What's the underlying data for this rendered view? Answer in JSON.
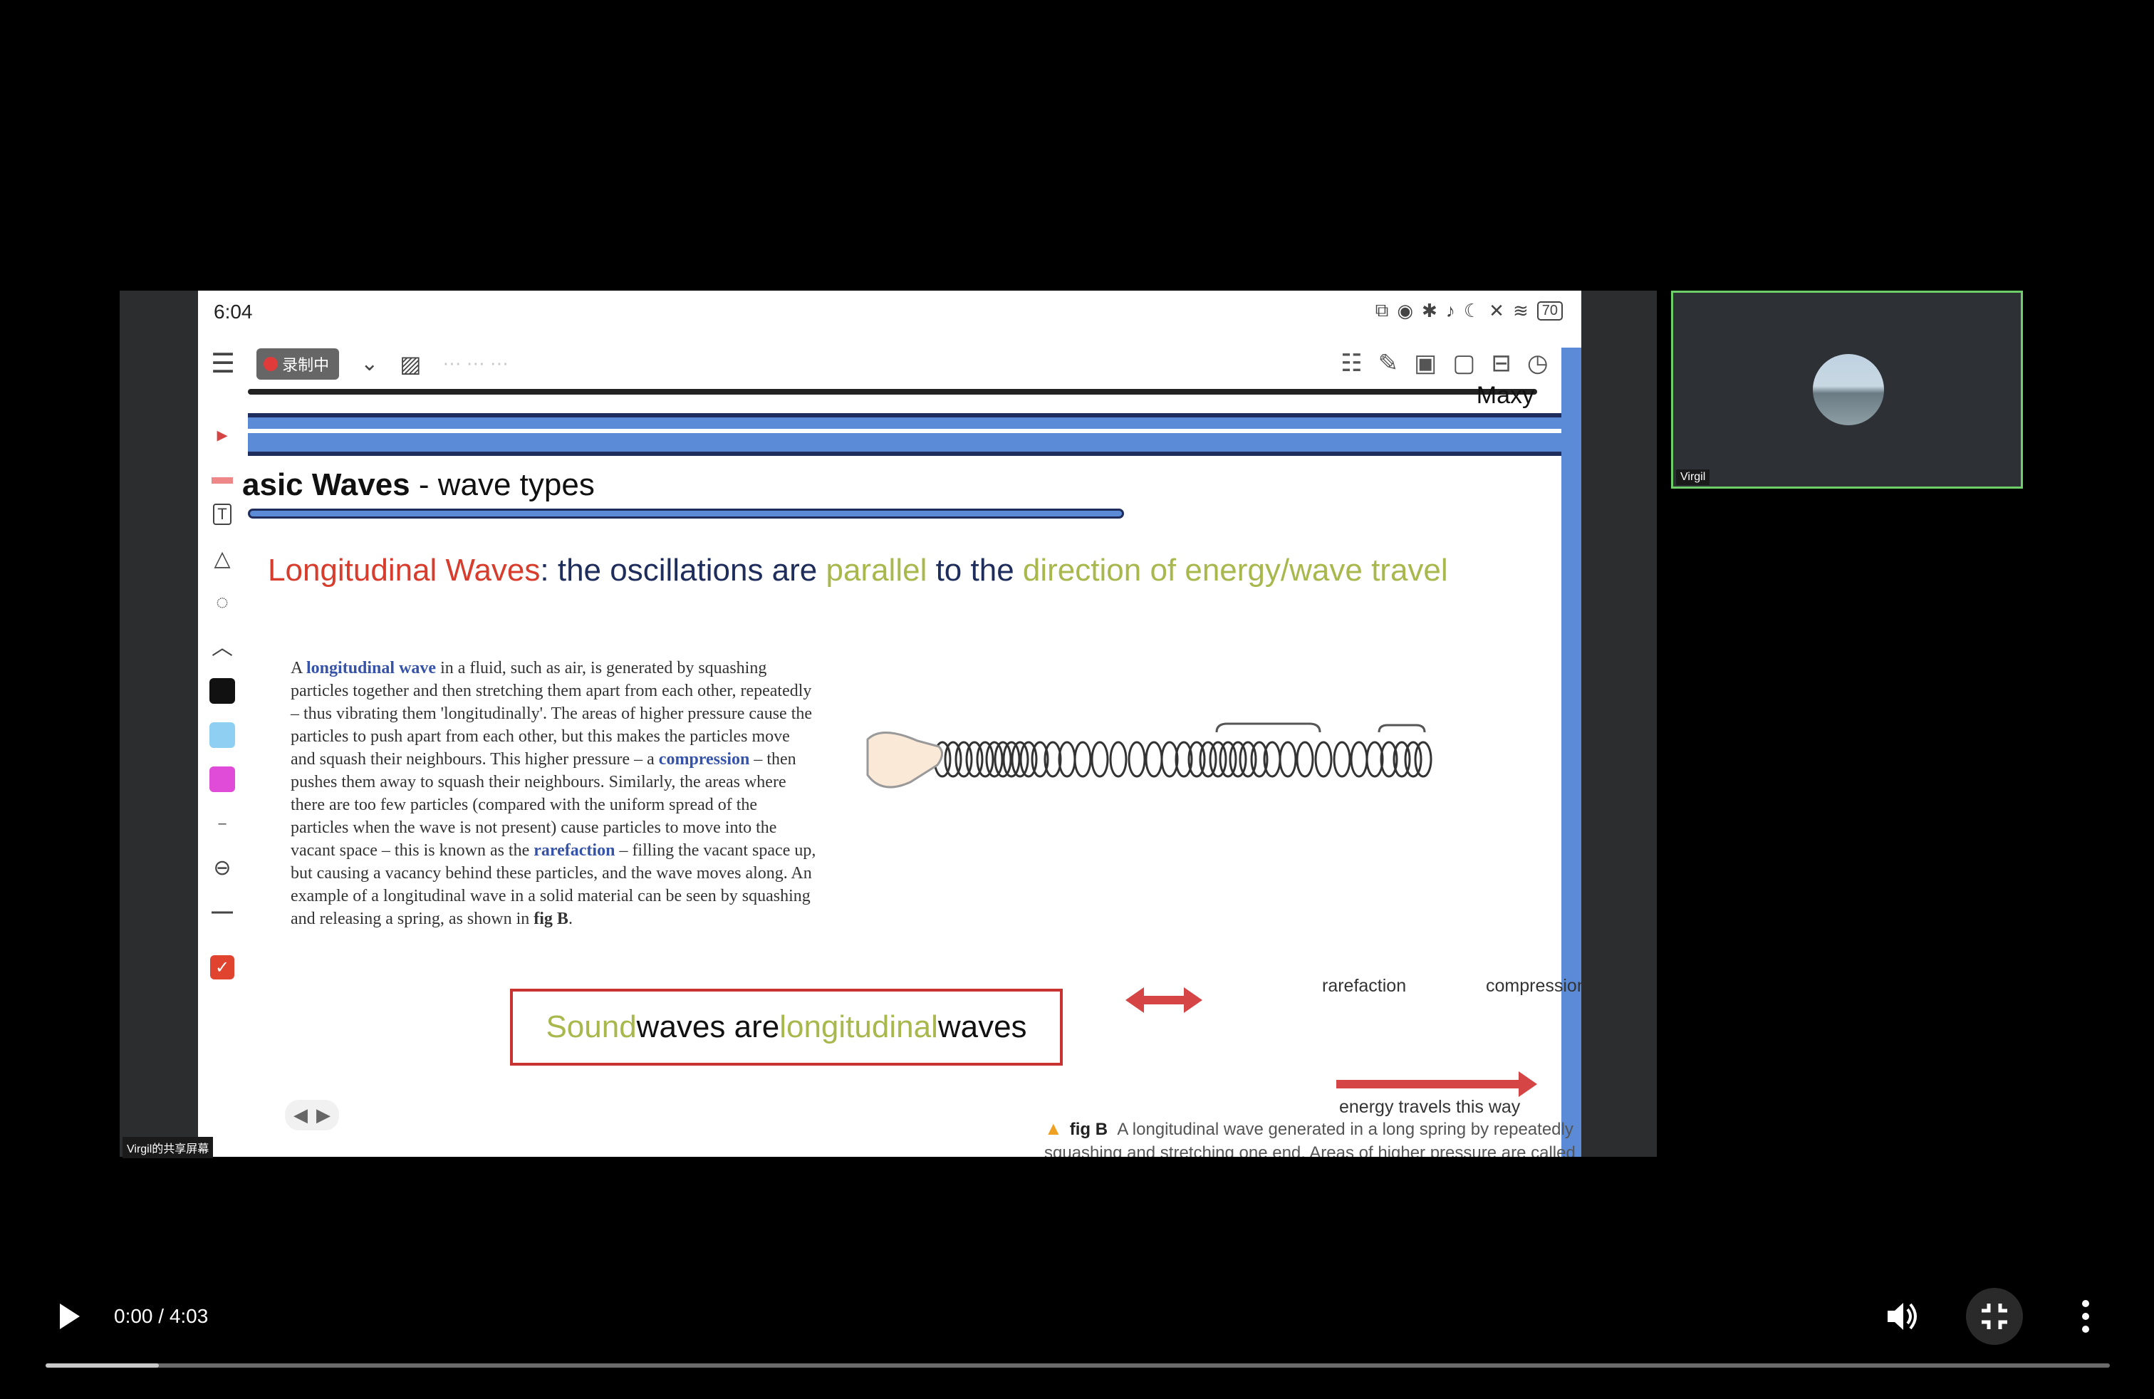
{
  "sharer_label": "Virgil的共享屏幕",
  "tablet": {
    "status_time": "6:04",
    "battery": "70",
    "recording_label": "录制中",
    "user_label": "Maxy"
  },
  "slide": {
    "title_bold": "asic Waves",
    "title_rest": " - wave types",
    "heading": {
      "part1": "Longitudinal Waves",
      "part2": ":  the oscillations are ",
      "part3": "parallel",
      "part4": " to the ",
      "part5": "direction of energy/wave travel"
    },
    "body": {
      "t1": "A ",
      "k1": "longitudinal wave",
      "t2": " in a fluid, such as air, is generated by squashing particles together and then stretching them apart from each other, repeatedly – thus vibrating them 'longitudinally'. The areas of higher pressure cause the particles to push apart from each other, but this makes the particles move and squash their neighbours. This higher pressure – a ",
      "k2": "compression",
      "t3": " – then pushes them away to squash their neighbours. Similarly, the areas where there are too few particles (compared with the uniform spread of the particles when the wave is not present) cause particles to move into the vacant space – this is known as the ",
      "k3": "rarefaction",
      "t4": " – filling the vacant space up, but causing a vacancy behind these particles, and the wave moves along. An example of a longitudinal wave in a solid material can be seen by squashing and releasing a spring, as shown in ",
      "k4": "fig B",
      "t5": "."
    },
    "figure": {
      "rarefaction": "rarefaction",
      "compression": "compression",
      "energy": "energy travels this way",
      "caption_label": "fig B",
      "caption_text": "A longitudinal wave generated in a long spring by repeatedly squashing and stretching one end. Areas of higher pressure are called compressions, and areas of lower pressure are called rarefactions."
    },
    "callout": {
      "w1": "Sound",
      "w2": " waves are ",
      "w3": "longitudinal",
      "w4": " waves"
    }
  },
  "participant": {
    "name": "Virgil"
  },
  "player": {
    "time": "0:00 / 4:03",
    "buffered_fraction": 0.055
  },
  "colors": {
    "accent_red": "#d73c2c",
    "accent_navy": "#1e2d5c",
    "accent_green": "#a8b84c",
    "band_blue": "#5b8bd6",
    "participant_border": "#6ecf6a"
  }
}
